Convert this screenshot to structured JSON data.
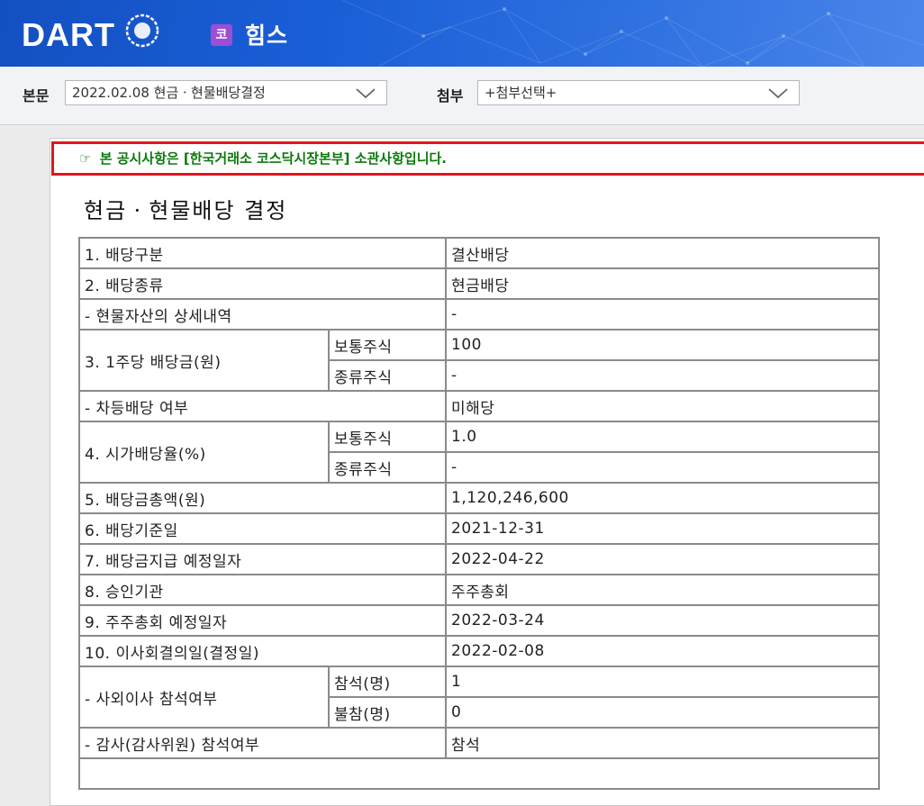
{
  "header": {
    "logo_text": "DART",
    "company_badge": "코",
    "company_name": "힘스"
  },
  "toolbar": {
    "body_label": "본문",
    "body_select_value": "2022.02.08  현금ㆍ현물배당결정",
    "attach_label": "첨부",
    "attach_select_value": "+첨부선택+"
  },
  "notice": {
    "icon": "pointing-hand-icon",
    "text": "본 공시사항은 [한국거래소 코스닥시장본부] 소관사항입니다."
  },
  "document": {
    "title": "현금ㆍ현물배당 결정",
    "rows": [
      {
        "label": "1. 배당구분",
        "value": "결산배당"
      },
      {
        "label": "2. 배당종류",
        "value": "현금배당"
      },
      {
        "label": "- 현물자산의 상세내역",
        "value": "-"
      },
      {
        "label": "3. 1주당 배당금(원)",
        "sub": [
          {
            "label": "보통주식",
            "value": "100"
          },
          {
            "label": "종류주식",
            "value": "-"
          }
        ]
      },
      {
        "label": "- 차등배당 여부",
        "value": "미해당"
      },
      {
        "label": "4. 시가배당율(%)",
        "sub": [
          {
            "label": "보통주식",
            "value": "1.0"
          },
          {
            "label": "종류주식",
            "value": "-"
          }
        ]
      },
      {
        "label": "5. 배당금총액(원)",
        "value": "1,120,246,600"
      },
      {
        "label": "6. 배당기준일",
        "value": "2021-12-31"
      },
      {
        "label": "7. 배당금지급 예정일자",
        "value": "2022-04-22"
      },
      {
        "label": "8. 승인기관",
        "value": "주주총회"
      },
      {
        "label": "9. 주주총회 예정일자",
        "value": "2022-03-24"
      },
      {
        "label": "10. 이사회결의일(결정일)",
        "value": "2022-02-08"
      },
      {
        "label": "- 사외이사 참석여부",
        "sub": [
          {
            "label": "참석(명)",
            "value": "1"
          },
          {
            "label": "불참(명)",
            "value": "0"
          }
        ]
      },
      {
        "label": "- 감사(감사위원) 참석여부",
        "value": "참석"
      }
    ]
  },
  "colors": {
    "header_blue": "#1a5ed6",
    "notice_border": "#e0161f",
    "notice_text": "#0a7a0a",
    "badge_purple": "#9b4fd6"
  }
}
